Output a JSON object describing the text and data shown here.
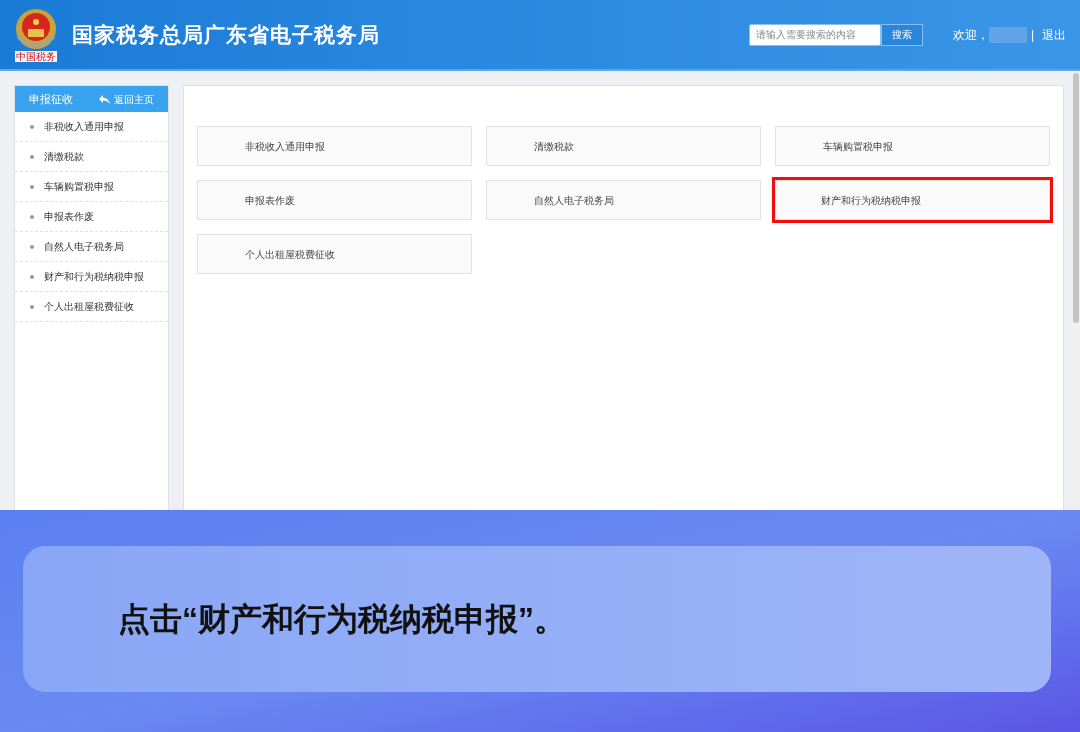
{
  "header": {
    "logo_caption": "中国税务",
    "title": "国家税务总局广东省电子税务局",
    "search": {
      "placeholder": "请输入需要搜索的内容",
      "button": "搜索"
    },
    "welcome": "欢迎，",
    "logout_separator": "|",
    "logout": "退出"
  },
  "sidebar": {
    "title": "申报征收",
    "back": "返回主页",
    "items": [
      {
        "label": "非税收入通用申报"
      },
      {
        "label": "清缴税款"
      },
      {
        "label": "车辆购置税申报"
      },
      {
        "label": "申报表作废"
      },
      {
        "label": "自然人电子税务局"
      },
      {
        "label": "财产和行为税纳税申报"
      },
      {
        "label": "个人出租屋税费征收"
      }
    ]
  },
  "tiles": [
    {
      "label": "非税收入通用申报",
      "highlighted": false
    },
    {
      "label": "清缴税款",
      "highlighted": false
    },
    {
      "label": "车辆购置税申报",
      "highlighted": false
    },
    {
      "label": "申报表作废",
      "highlighted": false
    },
    {
      "label": "自然人电子税务局",
      "highlighted": false
    },
    {
      "label": "财产和行为税纳税申报",
      "highlighted": true
    },
    {
      "label": "个人出租屋税费征收",
      "highlighted": false
    }
  ],
  "caption": "点击“财产和行为税纳税申报”。"
}
